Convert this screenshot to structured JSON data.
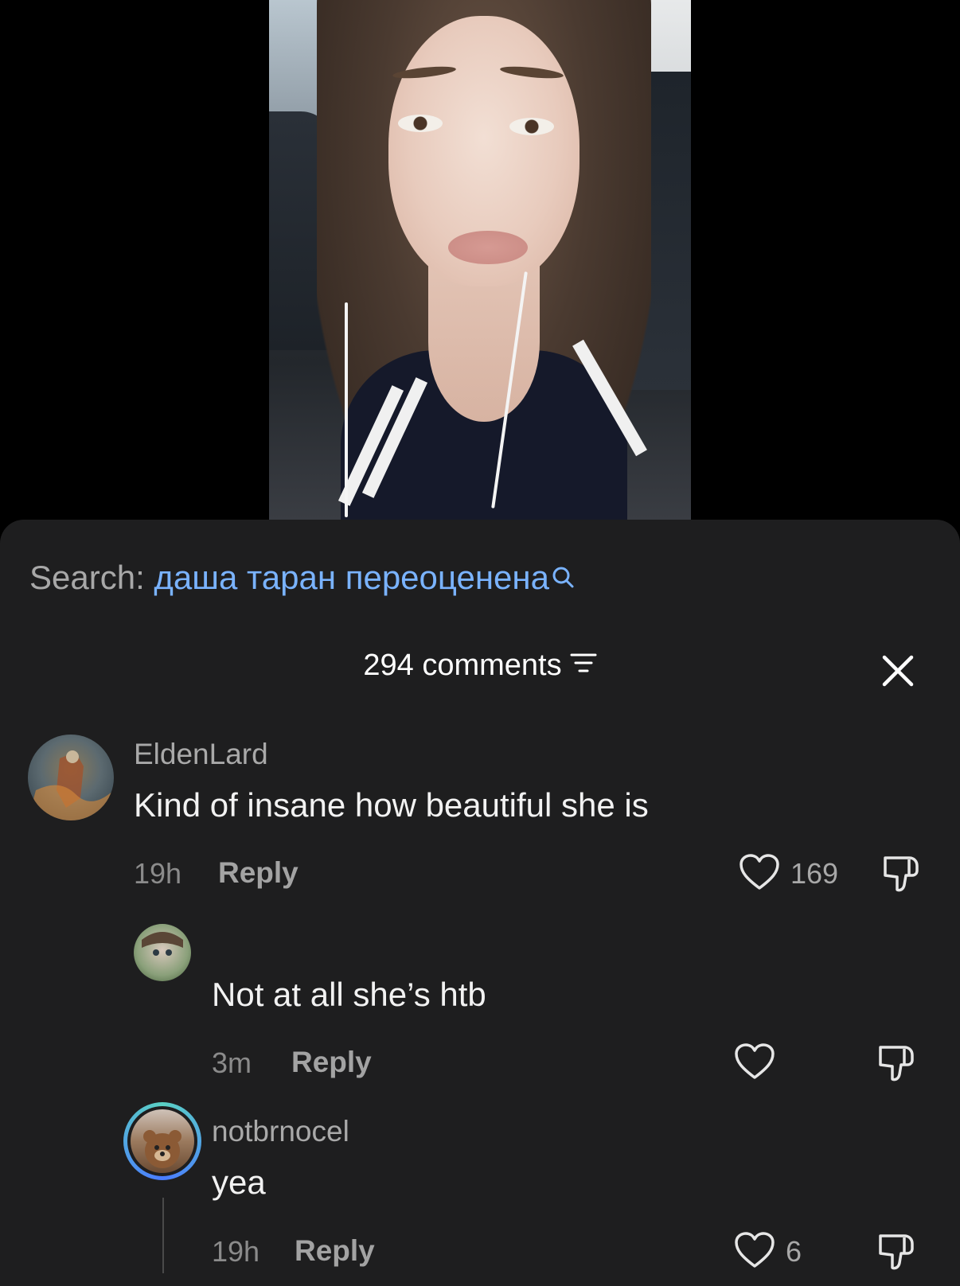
{
  "search": {
    "prefix": "Search:",
    "term": "даша таран переоценена"
  },
  "comments_header": {
    "count_label": "294 comments"
  },
  "comments": [
    {
      "username": "EldenLard",
      "text": "Kind of insane how beautiful she is",
      "time": "19h",
      "reply_label": "Reply",
      "likes": "169"
    },
    {
      "username": "",
      "text": "Not at all she’s htb",
      "time": "3m",
      "reply_label": "Reply",
      "likes": ""
    },
    {
      "username": "notbrnocel",
      "text": "yea",
      "time": "19h",
      "reply_label": "Reply",
      "likes": "6"
    }
  ],
  "icons": {
    "search": "search-icon",
    "filter": "filter-icon",
    "close": "close-icon",
    "like": "heart-icon",
    "dislike": "thumbs-down-icon"
  },
  "colors": {
    "sheet_bg": "#1e1e1f",
    "search_term": "#7ab3ff",
    "text": "#f2f2f2",
    "muted": "#a9a9a9"
  }
}
